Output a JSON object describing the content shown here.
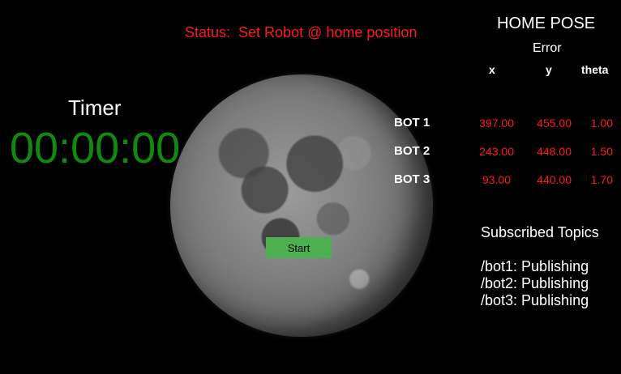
{
  "status": "Status:  Set Robot @ home position",
  "timer": {
    "label": "Timer",
    "value": "00:00:00"
  },
  "start_button": {
    "label": "Start"
  },
  "home_pose": {
    "title": "HOME POSE",
    "error_label": "Error",
    "columns": [
      "x",
      "y",
      "theta"
    ],
    "rows": [
      {
        "bot": "BOT 1",
        "x": "397.00",
        "y": "455.00",
        "theta": "1.00"
      },
      {
        "bot": "BOT 2",
        "x": "243.00",
        "y": "448.00",
        "theta": "1.50"
      },
      {
        "bot": "BOT 3",
        "x": "93.00",
        "y": "440.00",
        "theta": "1.70"
      }
    ]
  },
  "topics": {
    "title": "Subscribed Topics",
    "items": [
      "/bot1: Publishing",
      "/bot2: Publishing",
      "/bot3: Publishing"
    ]
  },
  "colors": {
    "background": "#000000",
    "status_text": "#ff1a1a",
    "timer_text": "#0f8a0f",
    "start_button": "#4caf50",
    "error_values": "#ff1a1a"
  }
}
